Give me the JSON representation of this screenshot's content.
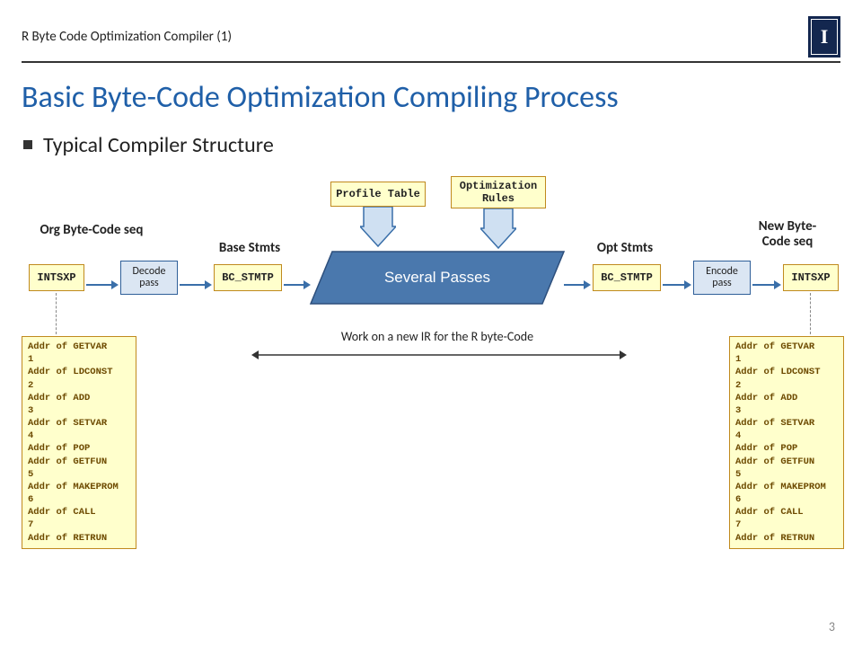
{
  "header": {
    "crumb": "R Byte Code Optimization Compiler (1)",
    "logo_letter": "I"
  },
  "title": "Basic Byte-Code Optimization Compiling Process",
  "subtitle": "Typical Compiler Structure",
  "labels": {
    "org": "Org Byte-Code seq",
    "base": "Base Stmts",
    "opt": "Opt Stmts",
    "newseq": "New Byte-\nCode seq"
  },
  "boxes": {
    "intsxp_l": "INTSXP",
    "decode": "Decode pass",
    "bcstmtp_l": "BC_STMTP",
    "profile": "Profile Table",
    "optrules": "Optimization Rules",
    "several": "Several Passes",
    "bcstmtp_r": "BC_STMTP",
    "encode": "Encode\npass",
    "intsxp_r": "INTSXP"
  },
  "note_ir": "Work on a new IR for the R byte-Code",
  "code_left": "Addr of GETVAR\n1\nAddr of LDCONST\n2\nAddr of ADD\n3\nAddr of SETVAR\n4\nAddr of POP\nAddr of GETFUN\n5\nAddr of MAKEPROM\n6\nAddr of CALL\n7\nAddr of RETRUN",
  "code_right": "Addr of GETVAR\n1\nAddr of LDCONST\n2\nAddr of ADD\n3\nAddr of SETVAR\n4\nAddr of POP\nAddr of GETFUN\n5\nAddr of MAKEPROM\n6\nAddr of CALL\n7\nAddr of RETRUN",
  "page_number": "3"
}
